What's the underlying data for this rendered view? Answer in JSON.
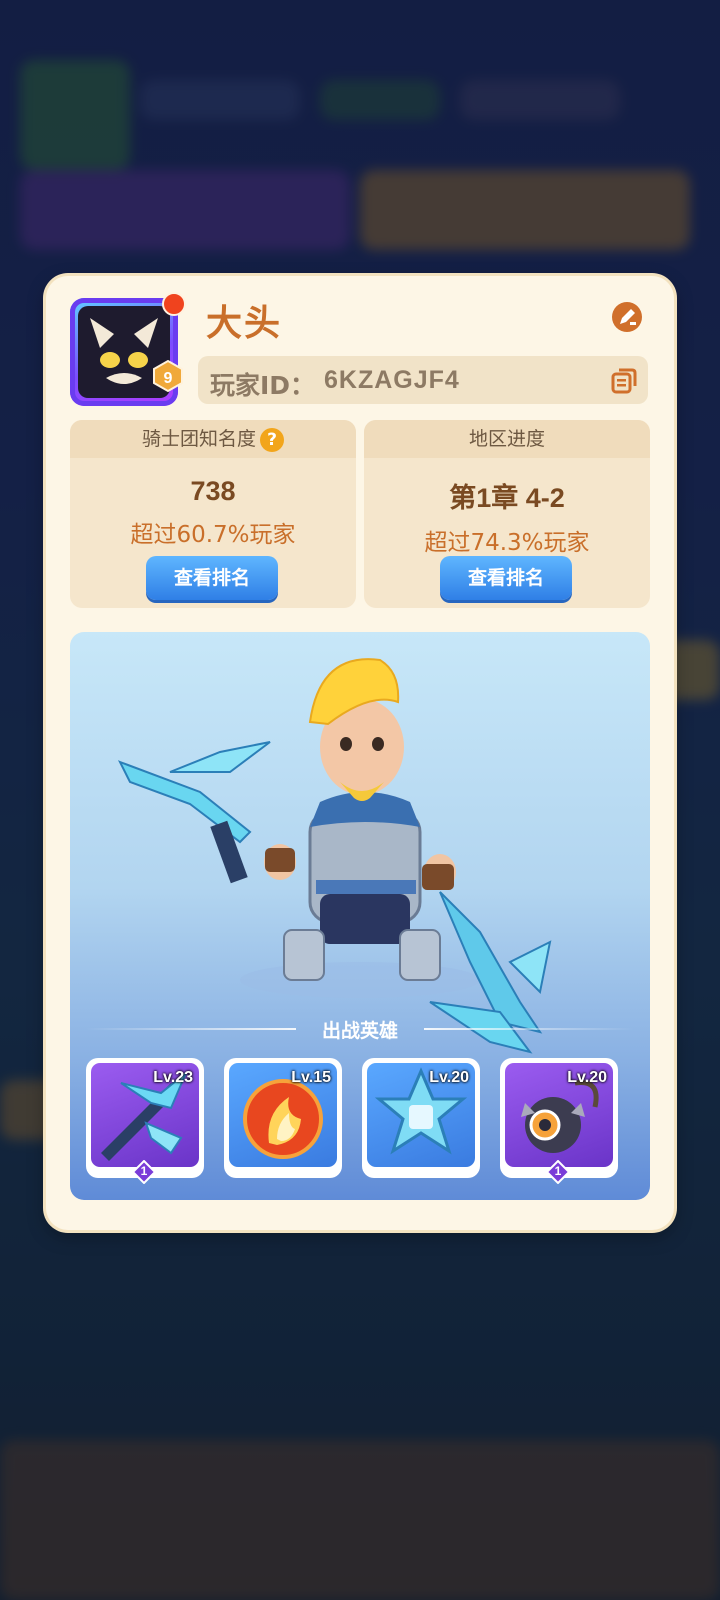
{
  "profile": {
    "name": "大头",
    "level": "9",
    "id_label": "玩家ID：",
    "id_value": "6KZAGJF4"
  },
  "stats": {
    "fame": {
      "title": "骑士团知名度",
      "value": "738",
      "sub": "超过60.7%玩家",
      "button": "查看排名",
      "help": "?"
    },
    "region": {
      "title": "地区进度",
      "value": "第1章 4-2",
      "sub": "超过74.3%玩家",
      "button": "查看排名"
    }
  },
  "battle": {
    "label": "出战英雄",
    "slots": [
      {
        "level": "Lv.23",
        "badge": "1",
        "icon": "ice-crossbow-icon",
        "color": "#8a4dd8"
      },
      {
        "level": "Lv.15",
        "badge": "",
        "icon": "fire-orb-icon",
        "color": "#3f86e6"
      },
      {
        "level": "Lv.20",
        "badge": "",
        "icon": "ice-star-icon",
        "color": "#3f86e6"
      },
      {
        "level": "Lv.20",
        "badge": "1",
        "icon": "spiked-bomb-icon",
        "color": "#8a4dd8"
      }
    ]
  },
  "colors": {
    "accent": "#c96f2a",
    "button_blue": "#2f7fe6",
    "card_bg": "#fdf6e6"
  }
}
